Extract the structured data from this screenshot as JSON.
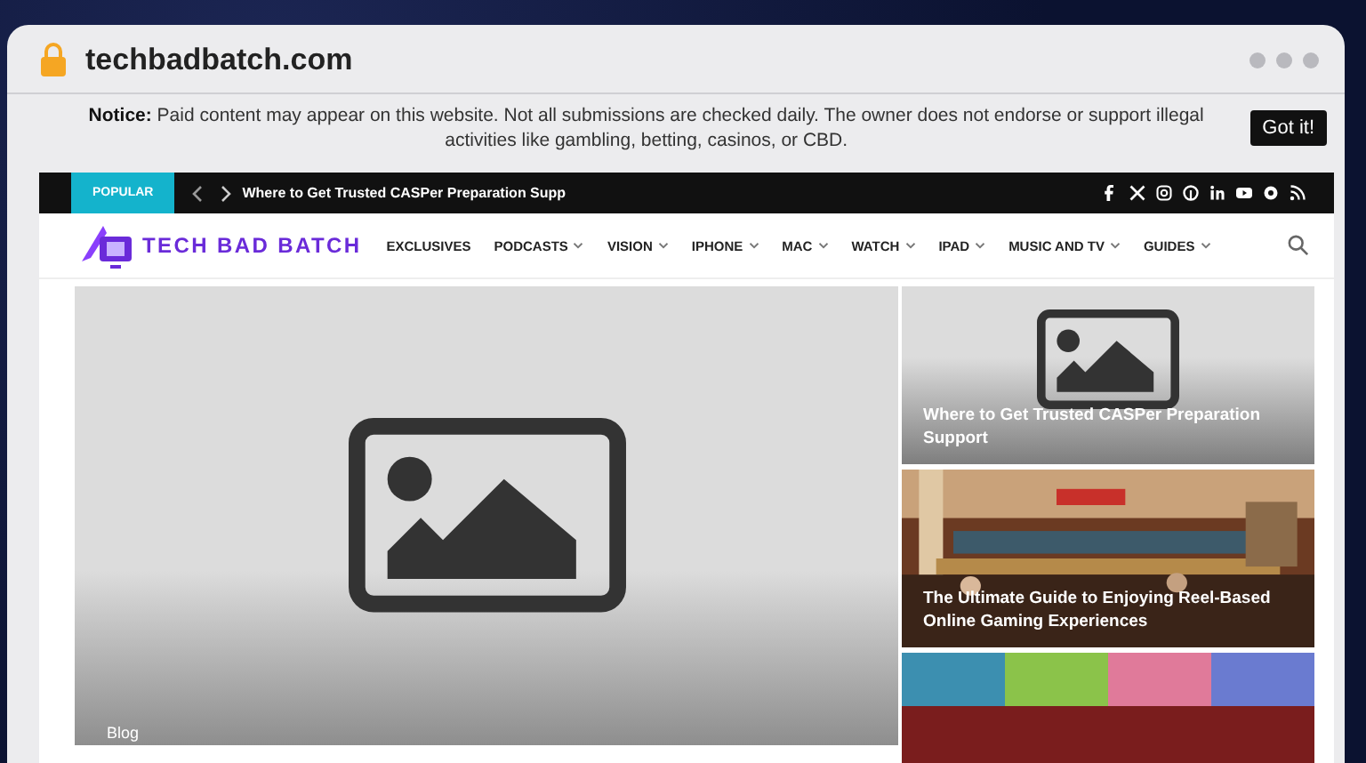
{
  "browser": {
    "url": "techbadbatch.com"
  },
  "notice": {
    "text": "**Notice:** Paid content may appear on this website. Not all submissions are checked daily. The owner does not endorse or support illegal activities like gambling, betting, casinos, or CBD.",
    "button": "Got it!"
  },
  "topbar": {
    "badge": "POPULAR",
    "ticker": "Where to Get Trusted CASPer Preparation Supp",
    "social": [
      {
        "kind": "facebook"
      },
      {
        "kind": "x"
      },
      {
        "kind": "instagram"
      },
      {
        "kind": "pinterest"
      },
      {
        "kind": "linkedin"
      },
      {
        "kind": "youtube"
      },
      {
        "kind": "circle"
      },
      {
        "kind": "rss"
      }
    ]
  },
  "nav": {
    "logo": "TECH BAD BATCH",
    "items": [
      {
        "label": "EXCLUSIVES",
        "dropdown": false
      },
      {
        "label": "PODCASTS",
        "dropdown": true
      },
      {
        "label": "VISION",
        "dropdown": true
      },
      {
        "label": "IPHONE",
        "dropdown": true
      },
      {
        "label": "MAC",
        "dropdown": true
      },
      {
        "label": "WATCH",
        "dropdown": true
      },
      {
        "label": "IPAD",
        "dropdown": true
      },
      {
        "label": "MUSIC AND TV",
        "dropdown": true
      },
      {
        "label": "GUIDES",
        "dropdown": true
      }
    ]
  },
  "featured": {
    "category": "Blog"
  },
  "side_posts": [
    {
      "kind": "placeholder",
      "title": "Where to Get Trusted CASPer Preparation Support"
    },
    {
      "kind": "casino",
      "title": "The Ultimate Guide to Enjoying Reel-Based Online Gaming Experiences"
    },
    {
      "kind": "blankets"
    }
  ]
}
